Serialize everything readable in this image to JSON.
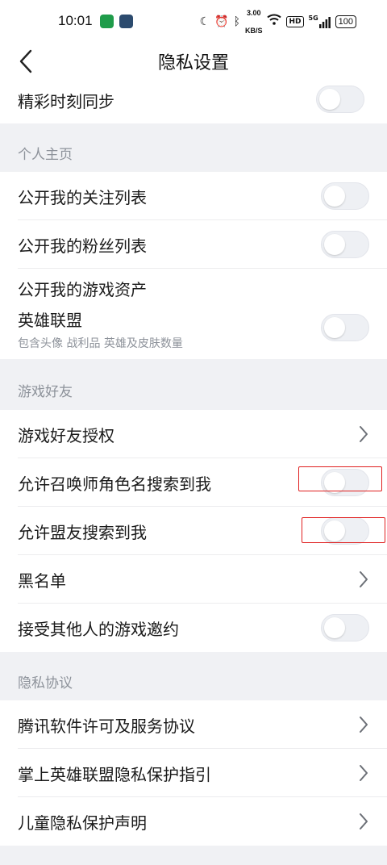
{
  "status_bar": {
    "time": "10:01",
    "speed_value": "3.00",
    "speed_unit": "KB/S",
    "hd": "HD",
    "network": "5G",
    "battery": "100"
  },
  "nav": {
    "title": "隐私设置"
  },
  "rows": {
    "highlight_sync": "精彩时刻同步",
    "section_profile": "个人主页",
    "follow_list": "公开我的关注列表",
    "fans_list": "公开我的粉丝列表",
    "game_assets": "公开我的游戏资产",
    "lol": "英雄联盟",
    "lol_desc": "包含头像 战利品 英雄及皮肤数量",
    "section_game_friends": "游戏好友",
    "friend_auth": "游戏好友授权",
    "summoner_search": "允许召唤师角色名搜索到我",
    "ally_search": "允许盟友搜索到我",
    "blacklist": "黑名单",
    "accept_invite": "接受其他人的游戏邀约",
    "section_privacy": "隐私协议",
    "tencent_license": "腾讯软件许可及服务协议",
    "privacy_guide": "掌上英雄联盟隐私保护指引",
    "child_privacy": "儿童隐私保护声明"
  },
  "colors": {
    "highlight_box": "#e02020",
    "section_text": "#8d929a",
    "toggle_off": "#eef0f4"
  }
}
